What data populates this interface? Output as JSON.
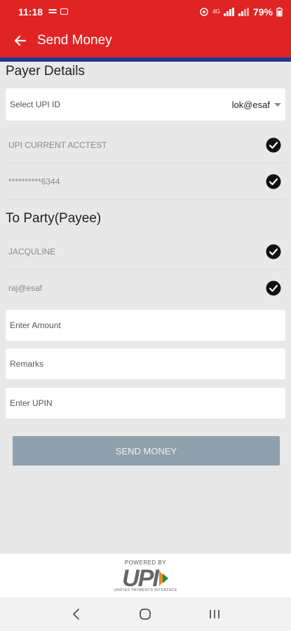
{
  "status_bar": {
    "time": "11:18",
    "battery": "79%",
    "network_label": "4G"
  },
  "app_bar": {
    "title": "Send Money"
  },
  "payer": {
    "section_title": "Payer Details",
    "upi_select_label": "Select UPI ID",
    "upi_selected_value": "lok@esaf",
    "account_name": "UPI CURRENT ACCTEST",
    "account_number": "**********6344"
  },
  "payee": {
    "section_title": "To Party(Payee)",
    "name": "JACQULINE",
    "vpa": "raj@esaf"
  },
  "form": {
    "amount_placeholder": "Enter Amount",
    "remarks_placeholder": "Remarks",
    "upin_placeholder": "Enter UPIN"
  },
  "send_button_label": "SEND MONEY",
  "footer": {
    "powered_by": "POWERED BY",
    "logo_text": "UPI",
    "logo_tagline": "UNIFIED PAYMENTS INTERFACE"
  },
  "colors": {
    "brand_red": "#e02424",
    "brand_blue": "#1f3a93",
    "button_disabled": "#8fa1ac"
  }
}
